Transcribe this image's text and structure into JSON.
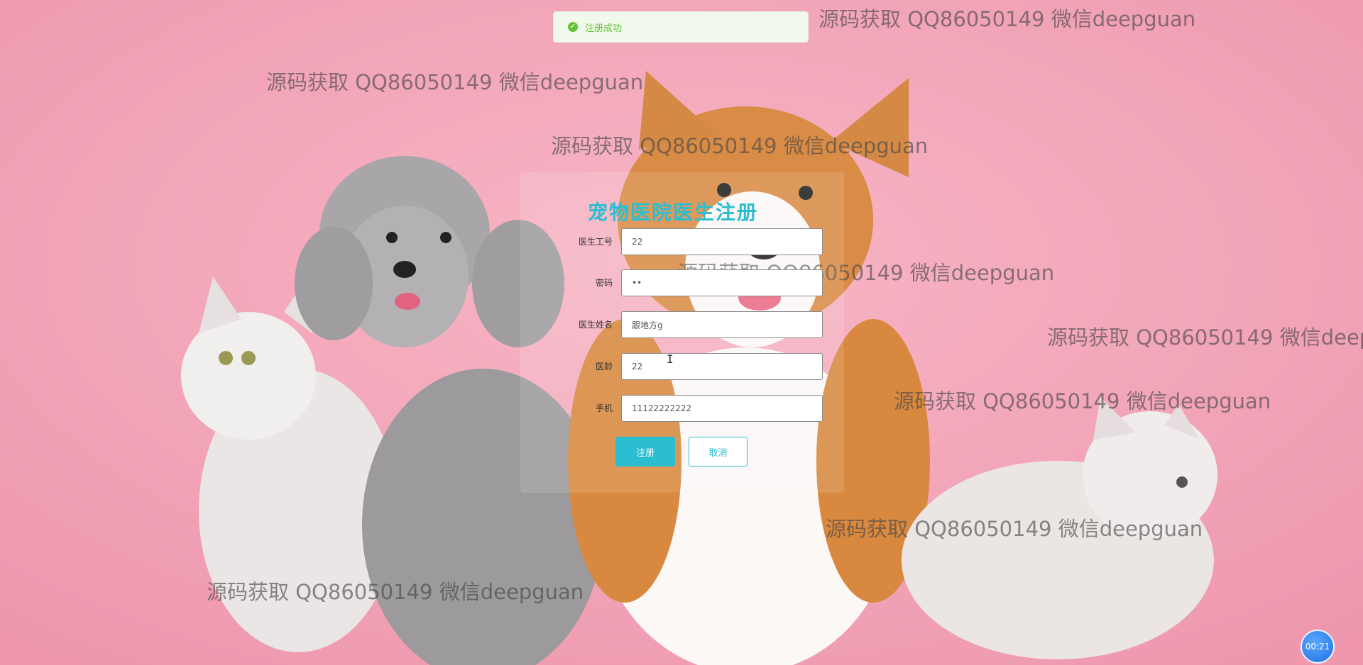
{
  "toast": {
    "icon": "check-circle-icon",
    "message": "注册成功"
  },
  "panel": {
    "title": "宠物医院医生注册"
  },
  "form": {
    "doctor_id": {
      "label": "医生工号",
      "value": "22"
    },
    "password": {
      "label": "密码",
      "value": "••"
    },
    "doctor_name": {
      "label": "医生姓名",
      "value": "跟地方g"
    },
    "years": {
      "label": "医龄",
      "value": "22"
    },
    "phone": {
      "label": "手机",
      "value": "11122222222"
    }
  },
  "buttons": {
    "register": "注册",
    "cancel": "取消"
  },
  "watermark": "源码获取 QQ86050149 微信deepguan",
  "timer": "00:21",
  "colors": {
    "accent": "#2bbed0",
    "background": "#f3a6b8",
    "success": "#67c23a"
  }
}
